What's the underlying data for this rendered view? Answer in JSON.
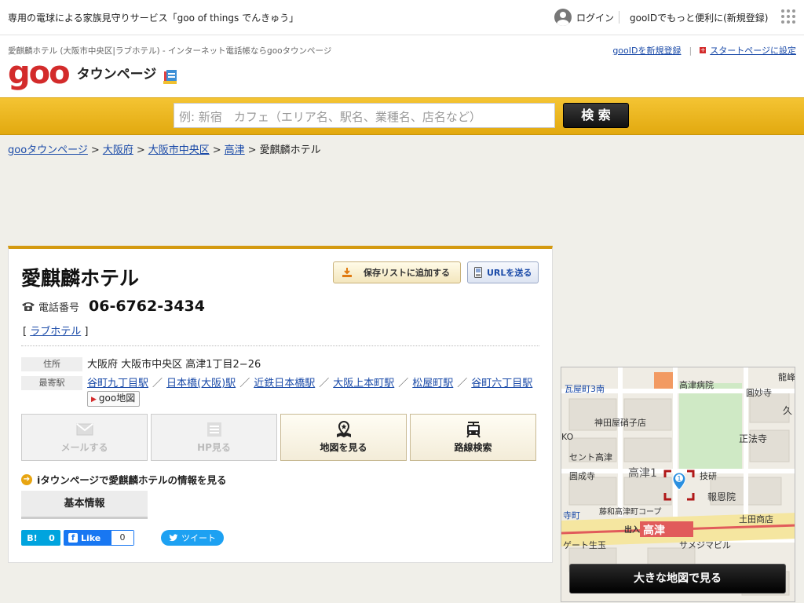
{
  "topbar": {
    "promo": "専用の電球による家族見守りサービス「goo of things でんきゅう」",
    "login": "ログイン",
    "register": "gooIDでもっと便利に(新規登録)"
  },
  "header": {
    "subtitle": "愛麒麟ホテル (大阪市中央区|ラブホテル) - インターネット電話帳ならgooタウンページ",
    "logo_goo": "goo",
    "logo_townpage": "タウンページ",
    "link_new_id": "gooIDを新規登録",
    "link_startpage": "スタートページに設定"
  },
  "search": {
    "placeholder": "例: 新宿　カフェ（エリア名、駅名、業種名、店名など）",
    "button": "検 索"
  },
  "breadcrumb": {
    "items": [
      "gooタウンページ",
      "大阪府",
      "大阪市中央区",
      "高津"
    ],
    "current": "愛麒麟ホテル"
  },
  "listing": {
    "name": "愛麒麟ホテル",
    "save_button": "保存リストに追加する",
    "url_button": "URLを送る",
    "phone_label": "電話番号",
    "phone": "06-6762-3434",
    "category": "ラブホテル",
    "address_label": "住所",
    "address": "大阪府 大阪市中央区 高津1丁目2−26",
    "station_label": "最寄駅",
    "stations": [
      "谷町九丁目駅",
      "日本橋(大阪)駅",
      "近鉄日本橋駅",
      "大阪上本町駅",
      "松屋町駅",
      "谷町六丁目駅"
    ],
    "goo_map": "goo地図",
    "actions": {
      "mail": "メールする",
      "hp": "HP見る",
      "map": "地図を見る",
      "route": "路線検索"
    },
    "itown_text": "iタウンページで愛麒麟ホテルの情報を見る",
    "basic_tab": "基本情報"
  },
  "social": {
    "hatena_label": "B!",
    "hatena_count": "0",
    "fb_label": "Like",
    "fb_count": "0",
    "tweet": "ツイート"
  },
  "map": {
    "labels": {
      "l1": "瓦屋町3南",
      "l2": "高津病院",
      "l3": "圓妙寺",
      "l4": "龍峰",
      "l5": "神田屋硝子店",
      "l6": "正法寺",
      "l7": "セント高津",
      "l8": "圓成寺",
      "l9": "高津1",
      "l10": "技研",
      "l11": "報恩院",
      "l12": "藤和高津町コープ",
      "l13": "土田商店",
      "l14": "高津",
      "l15": "出入",
      "l16": "サメジマビル",
      "l17": "ゲート生玉",
      "l18": "寺町",
      "l19": "KO",
      "l20": "久"
    },
    "marker": "1",
    "button": "大きな地図で見る",
    "colors": {
      "road": "#ffffff",
      "park": "#cfe9c5",
      "major_road": "#f5e6a0",
      "rail": "#e15b5b"
    }
  }
}
